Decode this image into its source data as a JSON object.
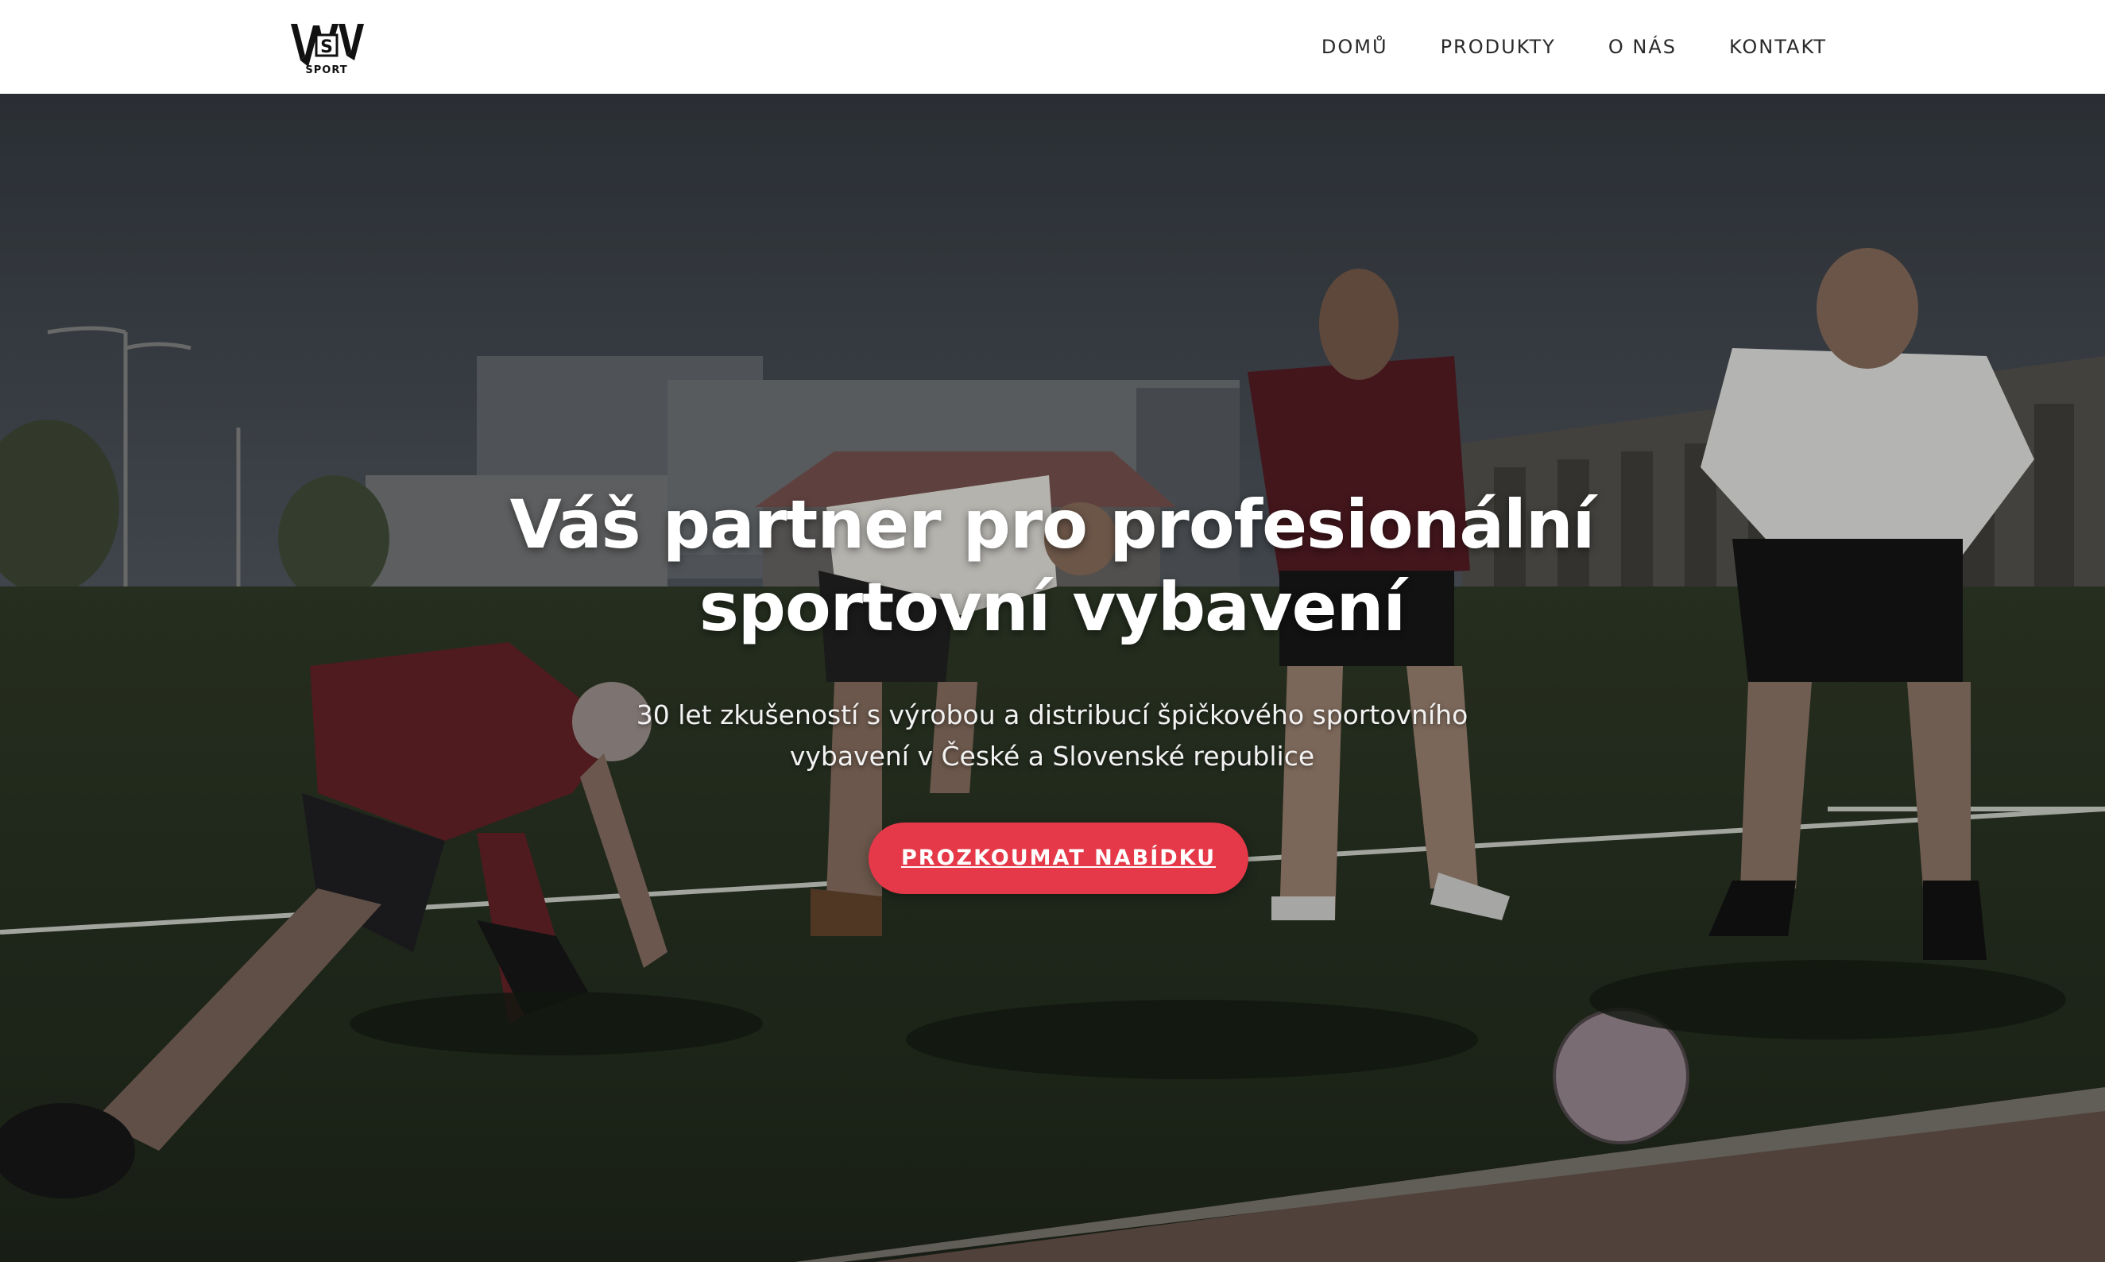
{
  "brand": {
    "logo_letters": "VSWV",
    "logo_subtext": "SPORT"
  },
  "nav": {
    "items": [
      {
        "label": "DOMŮ"
      },
      {
        "label": "PRODUKTY"
      },
      {
        "label": "O NÁS"
      },
      {
        "label": "KONTAKT"
      }
    ]
  },
  "hero": {
    "title_line1": "Váš partner pro profesionální",
    "title_line2": "sportovní vybavení",
    "subtitle_line1": "30 let zkušeností s výrobou a distribucí špičkového sportovního",
    "subtitle_line2": "vybavení v České a Slovenské republice",
    "cta_label": "PROZKOUMAT NABÍDKU",
    "background_image": "football-players-stretching-on-artificial-turf"
  },
  "colors": {
    "accent": "#e53848",
    "header_bg": "#ffffff",
    "nav_text": "#2a2a2a"
  }
}
